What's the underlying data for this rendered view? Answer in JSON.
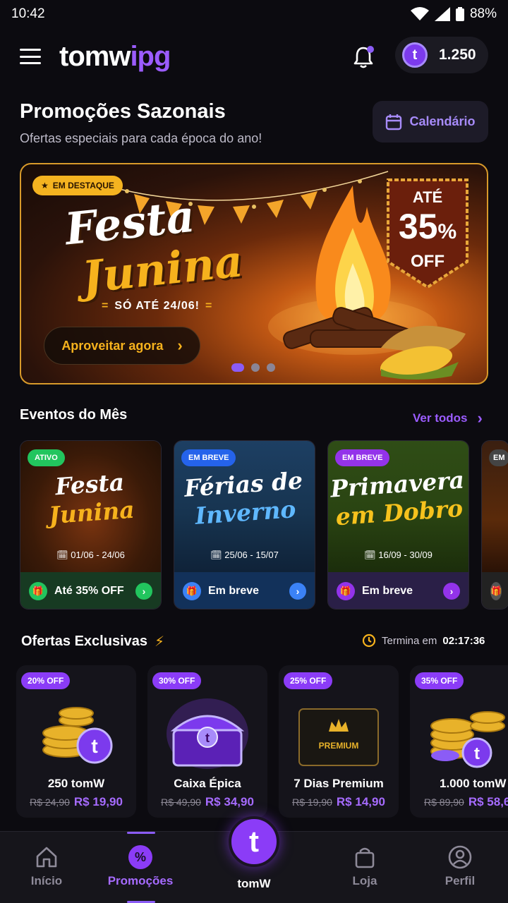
{
  "status_bar": {
    "time": "10:42",
    "battery": "88%"
  },
  "header": {
    "logo_part1": "tomw",
    "logo_part2": "ipg",
    "coin_balance": "1.250",
    "coin_symbol": "t"
  },
  "page": {
    "title": "Promoções Sazonais",
    "subtitle": "Ofertas especiais para cada época do ano!",
    "calendar_button": "Calendário"
  },
  "hero": {
    "badge": "EM DESTAQUE",
    "title_line1": "Festa",
    "title_line2": "Junina",
    "until": "SÓ ATÉ 24/06!",
    "discount_top": "ATÉ",
    "discount_value": "35",
    "discount_percent": "%",
    "discount_bottom": "OFF",
    "cta": "Aproveitar agora",
    "slides": 3,
    "active_slide": 1
  },
  "events_section": {
    "title": "Eventos do Mês",
    "see_all": "Ver todos",
    "events": [
      {
        "badge": "ATIVO",
        "badge_color": "#22c55e",
        "name_line1": "Festa",
        "name_line2": "Junina",
        "date": "01/06 - 24/06",
        "footer": "Até 35% OFF",
        "accent": "#22c55e"
      },
      {
        "badge": "EM BREVE",
        "badge_color": "#2563eb",
        "name_line1": "Férias de",
        "name_line2": "Inverno",
        "date": "25/06 - 15/07",
        "footer": "Em breve",
        "accent": "#3b82f6"
      },
      {
        "badge": "EM BREVE",
        "badge_color": "#9333ea",
        "name_line1": "Primavera",
        "name_line2": "em Dobro",
        "date": "16/09 - 30/09",
        "footer": "Em breve",
        "accent": "#9333ea"
      },
      {
        "badge": "EM",
        "badge_color": "#444",
        "name_line1": "",
        "name_line2": "",
        "date": "",
        "footer": "",
        "accent": "#888"
      }
    ]
  },
  "offers_section": {
    "title": "Ofertas Exclusivas",
    "timer_label": "Termina em",
    "timer_value": "02:17:36",
    "offers": [
      {
        "badge": "20% OFF",
        "name": "250 tomW",
        "old_price": "R$ 24,90",
        "new_price": "R$ 19,90",
        "art": "coins-icon"
      },
      {
        "badge": "30% OFF",
        "name": "Caixa Épica",
        "old_price": "R$ 49,90",
        "new_price": "R$ 34,90",
        "art": "chest-icon"
      },
      {
        "badge": "25% OFF",
        "name": "7 Dias Premium",
        "old_price": "R$ 19,90",
        "new_price": "R$ 14,90",
        "art": "premium-card-icon",
        "art_label": "PREMIUM"
      },
      {
        "badge": "35% OFF",
        "name": "1.000 tomW",
        "old_price": "R$ 89,90",
        "new_price": "R$ 58,6",
        "art": "coins-icon"
      }
    ]
  },
  "bottom_nav": {
    "items": [
      {
        "label": "Início",
        "icon": "home-icon"
      },
      {
        "label": "Promoções",
        "icon": "percent-icon",
        "active": true
      },
      {
        "label": "tomW",
        "icon": "t-coin-icon"
      },
      {
        "label": "Loja",
        "icon": "bag-icon"
      },
      {
        "label": "Perfil",
        "icon": "user-icon"
      }
    ],
    "center_symbol": "t"
  },
  "colors": {
    "accent": "#8b5cf6",
    "gold": "#f6b21d",
    "background": "#0c0b10"
  }
}
